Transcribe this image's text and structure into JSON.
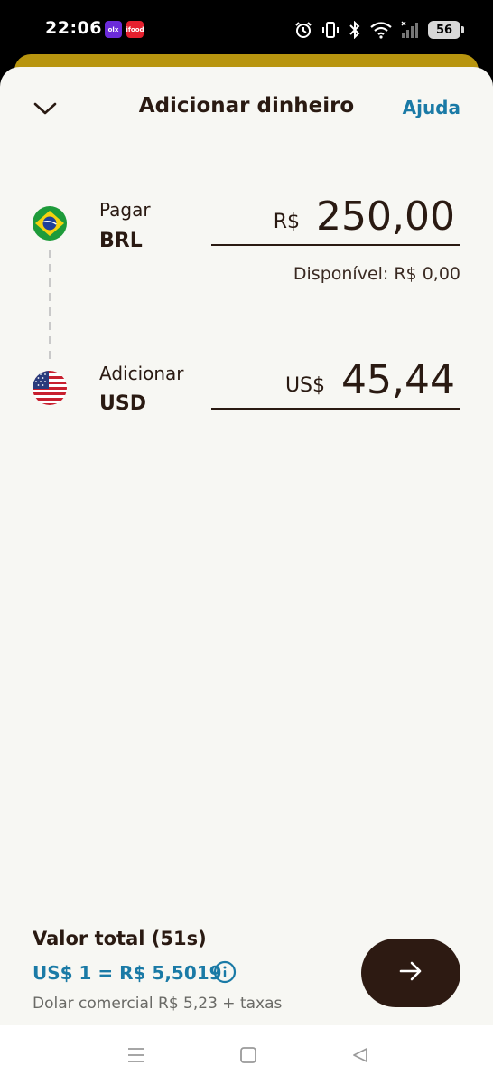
{
  "status_bar": {
    "time": "22:06",
    "app_icons": [
      {
        "name": "olx-app-icon",
        "text": "olx",
        "color": "#6b2bd9"
      },
      {
        "name": "ifood-app-icon",
        "text": "ifood",
        "color": "#e5202e"
      }
    ],
    "battery": "56",
    "icons": [
      "alarm-icon",
      "vibrate-icon",
      "bluetooth-icon",
      "wifi-icon",
      "signal-icon",
      "battery-icon"
    ]
  },
  "header": {
    "title": "Adicionar dinheiro",
    "help_label": "Ajuda",
    "close_icon": "chevron-down-icon"
  },
  "pay": {
    "label": "Pagar",
    "currency_code": "BRL",
    "currency_symbol": "R$",
    "amount": "250,00",
    "available": "Disponível: R$ 0,00",
    "flag": "brazil-flag-icon"
  },
  "add": {
    "label": "Adicionar",
    "currency_code": "USD",
    "currency_symbol": "US$",
    "amount": "45,44",
    "flag": "usa-flag-icon"
  },
  "summary": {
    "total_title": "Valor total (51s)",
    "rate": "US$ 1 = R$ 5,5019",
    "fees": "Dolar comercial R$ 5,23 + taxas"
  },
  "colors": {
    "accent_blue": "#1a7aa6",
    "primary_dark": "#2d1a12",
    "gold": "#b8950f",
    "background": "#f7f7f3"
  }
}
